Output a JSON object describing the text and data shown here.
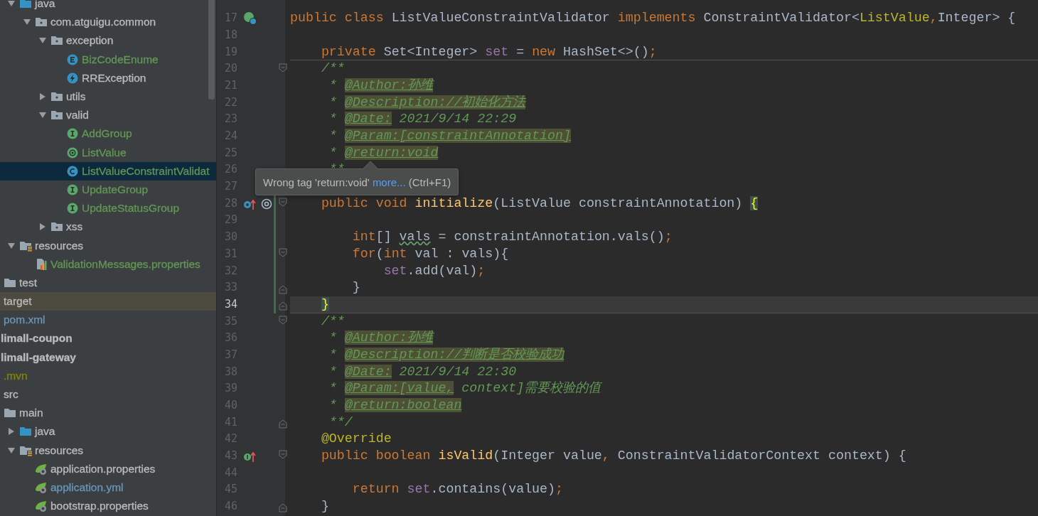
{
  "tree": [
    {
      "label": "java",
      "kind": "java-folder",
      "expanded": true,
      "selected": false,
      "color": "#bbbbbb",
      "children": [
        {
          "label": "com.atguigu.common",
          "kind": "package",
          "expanded": true,
          "selected": false,
          "color": "#bbbbbb",
          "children": [
            {
              "label": "exception",
              "kind": "package",
              "expanded": true,
              "selected": false,
              "color": "#bbbbbb",
              "children": [
                {
                  "label": "BizCodeEnume",
                  "kind": "enum",
                  "selected": false,
                  "color": "#629755"
                },
                {
                  "label": "RRException",
                  "kind": "exception",
                  "selected": false,
                  "color": "#bbbbbb"
                }
              ]
            },
            {
              "label": "utils",
              "kind": "package",
              "expanded": false,
              "selected": false,
              "color": "#bbbbbb"
            },
            {
              "label": "valid",
              "kind": "package",
              "expanded": true,
              "selected": false,
              "color": "#bbbbbb",
              "children": [
                {
                  "label": "AddGroup",
                  "kind": "interface",
                  "selected": false,
                  "color": "#629755"
                },
                {
                  "label": "ListValue",
                  "kind": "annotation",
                  "selected": false,
                  "color": "#629755"
                },
                {
                  "label": "ListValueConstraintValidat",
                  "kind": "class",
                  "selected": true,
                  "color": "#629755"
                },
                {
                  "label": "UpdateGroup",
                  "kind": "interface",
                  "selected": false,
                  "color": "#629755"
                },
                {
                  "label": "UpdateStatusGroup",
                  "kind": "interface",
                  "selected": false,
                  "color": "#629755"
                }
              ]
            },
            {
              "label": "xss",
              "kind": "package",
              "expanded": false,
              "selected": false,
              "color": "#bbbbbb"
            }
          ]
        }
      ]
    },
    {
      "label": "resources",
      "kind": "resource-folder",
      "expanded": true,
      "selected": false,
      "color": "#bbbbbb",
      "children": [
        {
          "label": "ValidationMessages.properties",
          "kind": "bundle",
          "selected": false,
          "color": "#629755"
        }
      ]
    },
    {
      "label": "test",
      "kind": "test-folder",
      "selected": false,
      "color": "#bbbbbb"
    },
    {
      "label": "target",
      "kind": "excluded-folder",
      "selected": false,
      "color": "#bbbbbb"
    },
    {
      "label": "pom.xml",
      "kind": "pom-file",
      "selected": false,
      "color": "#6897bb"
    },
    {
      "label": "limall-coupon",
      "kind": "module",
      "selected": false,
      "color": "#bbbbbb"
    },
    {
      "label": "limall-gateway",
      "kind": "module",
      "selected": false,
      "color": "#bbbbbb",
      "children": [
        {
          "label": ".mvn",
          "kind": "folder",
          "selected": false,
          "color": "#848504"
        },
        {
          "label": "src",
          "kind": "folder",
          "selected": false,
          "color": "#bbbbbb",
          "children": [
            {
              "label": "main",
              "kind": "folder",
              "selected": false,
              "color": "#bbbbbb",
              "children": [
                {
                  "label": "java",
                  "kind": "java-folder",
                  "expanded": false,
                  "selected": false,
                  "color": "#bbbbbb"
                },
                {
                  "label": "resources",
                  "kind": "resource-folder",
                  "expanded": true,
                  "selected": false,
                  "color": "#bbbbbb",
                  "children": [
                    {
                      "label": "application.properties",
                      "kind": "spring-config",
                      "selected": false,
                      "color": "#bbbbbb"
                    },
                    {
                      "label": "application.yml",
                      "kind": "spring-config",
                      "selected": false,
                      "color": "#6897bb"
                    },
                    {
                      "label": "bootstrap.properties",
                      "kind": "spring-config",
                      "selected": false,
                      "color": "#bbbbbb"
                    }
                  ]
                }
              ]
            }
          ]
        }
      ]
    }
  ],
  "editor": {
    "lines": [
      {
        "number": "17",
        "current": false,
        "separator": false,
        "changed": false,
        "gutter": {
          "kind": "subclassed"
        },
        "tokens": [
          {
            "kind": "keyword",
            "text": "public class "
          },
          {
            "kind": "plain",
            "text": "ListValueConstraintValidator "
          },
          {
            "kind": "keyword",
            "text": "implements "
          },
          {
            "kind": "plain",
            "text": "ConstraintValidator<"
          },
          {
            "kind": "generic",
            "text": "ListValue"
          },
          {
            "kind": "keyword",
            "text": ","
          },
          {
            "kind": "plain",
            "text": "Integer> {"
          }
        ]
      },
      {
        "number": "18",
        "current": false,
        "separator": false,
        "changed": false
      },
      {
        "number": "19",
        "current": false,
        "separator": true,
        "changed": false,
        "tokens": [
          {
            "kind": "keyword",
            "text": "    private "
          },
          {
            "kind": "plain",
            "text": "Set<Integer> "
          },
          {
            "kind": "field",
            "text": "set"
          },
          {
            "kind": "plain",
            "text": " = "
          },
          {
            "kind": "keyword",
            "text": "new "
          },
          {
            "kind": "plain",
            "text": "HashSet<>()"
          },
          {
            "kind": "keyword",
            "text": ";"
          }
        ]
      },
      {
        "number": "20",
        "current": false,
        "separator": false,
        "changed": false,
        "fold": {
          "kind": "start"
        },
        "tokens": [
          {
            "kind": "comment",
            "text": "    /**"
          }
        ]
      },
      {
        "number": "21",
        "current": false,
        "separator": false,
        "changed": false,
        "tokens": [
          {
            "kind": "comment",
            "text": "     * "
          },
          {
            "kind": "doc-tag",
            "text": "@Author:孙维"
          }
        ]
      },
      {
        "number": "22",
        "current": false,
        "separator": false,
        "changed": false,
        "tokens": [
          {
            "kind": "comment",
            "text": "     * "
          },
          {
            "kind": "doc-tag",
            "text": "@Description://初始化方法"
          }
        ]
      },
      {
        "number": "23",
        "current": false,
        "separator": false,
        "changed": false,
        "tokens": [
          {
            "kind": "comment",
            "text": "     * "
          },
          {
            "kind": "doc-tag",
            "text": "@Date:"
          },
          {
            "kind": "comment",
            "text": " 2021/9/14 22:29"
          }
        ]
      },
      {
        "number": "24",
        "current": false,
        "separator": false,
        "changed": false,
        "tokens": [
          {
            "kind": "comment",
            "text": "     * "
          },
          {
            "kind": "doc-tag",
            "text": "@Param:[constraintAnnotation]"
          }
        ]
      },
      {
        "number": "25",
        "current": false,
        "separator": false,
        "changed": false,
        "tokens": [
          {
            "kind": "comment",
            "text": "     * "
          },
          {
            "kind": "doc-tag",
            "text": "@return:void"
          }
        ]
      },
      {
        "number": "26",
        "current": false,
        "separator": false,
        "changed": false,
        "tokens": [
          {
            "kind": "comment",
            "text": "     **"
          }
        ]
      },
      {
        "number": "27",
        "current": false,
        "separator": false,
        "changed": false
      },
      {
        "number": "28",
        "current": false,
        "separator": false,
        "changed": true,
        "gutter": {
          "kind": "implementing-annotated"
        },
        "fold": {
          "kind": "start"
        },
        "tokens": [
          {
            "kind": "keyword",
            "text": "    public void "
          },
          {
            "kind": "method",
            "text": "initialize"
          },
          {
            "kind": "plain",
            "text": "(ListValue constraintAnnotation) "
          },
          {
            "kind": "brace-match",
            "text": "{"
          }
        ]
      },
      {
        "number": "29",
        "current": false,
        "separator": false,
        "changed": true
      },
      {
        "number": "30",
        "current": false,
        "separator": false,
        "changed": true,
        "tokens": [
          {
            "kind": "keyword",
            "text": "        int"
          },
          {
            "kind": "plain",
            "text": "[] "
          },
          {
            "kind": "typo",
            "text": "vals"
          },
          {
            "kind": "plain",
            "text": " = constraintAnnotation.vals()"
          },
          {
            "kind": "keyword",
            "text": ";"
          }
        ]
      },
      {
        "number": "31",
        "current": false,
        "separator": false,
        "changed": true,
        "fold": {
          "kind": "start"
        },
        "tokens": [
          {
            "kind": "keyword",
            "text": "        for"
          },
          {
            "kind": "plain",
            "text": "("
          },
          {
            "kind": "keyword",
            "text": "int "
          },
          {
            "kind": "plain",
            "text": "val : vals){"
          }
        ]
      },
      {
        "number": "32",
        "current": false,
        "separator": false,
        "changed": true,
        "tokens": [
          {
            "kind": "field",
            "text": "            set"
          },
          {
            "kind": "plain",
            "text": ".add(val)"
          },
          {
            "kind": "keyword",
            "text": ";"
          }
        ]
      },
      {
        "number": "33",
        "current": false,
        "separator": false,
        "changed": true,
        "fold": {
          "kind": "end"
        },
        "tokens": [
          {
            "kind": "plain",
            "text": "        }"
          }
        ]
      },
      {
        "number": "34",
        "current": true,
        "separator": true,
        "changed": true,
        "fold": {
          "kind": "end"
        },
        "tokens": [
          {
            "kind": "brace-match",
            "text": "    }"
          }
        ]
      },
      {
        "number": "35",
        "current": false,
        "separator": false,
        "changed": false,
        "fold": {
          "kind": "start"
        },
        "tokens": [
          {
            "kind": "comment",
            "text": "    /**"
          }
        ]
      },
      {
        "number": "36",
        "current": false,
        "separator": false,
        "changed": false,
        "tokens": [
          {
            "kind": "comment",
            "text": "     * "
          },
          {
            "kind": "doc-tag",
            "text": "@Author:孙维"
          }
        ]
      },
      {
        "number": "37",
        "current": false,
        "separator": false,
        "changed": false,
        "tokens": [
          {
            "kind": "comment",
            "text": "     * "
          },
          {
            "kind": "doc-tag",
            "text": "@Description://判断是否校验成功"
          }
        ]
      },
      {
        "number": "38",
        "current": false,
        "separator": false,
        "changed": false,
        "tokens": [
          {
            "kind": "comment",
            "text": "     * "
          },
          {
            "kind": "doc-tag",
            "text": "@Date:"
          },
          {
            "kind": "comment",
            "text": " 2021/9/14 22:30"
          }
        ]
      },
      {
        "number": "39",
        "current": false,
        "separator": false,
        "changed": false,
        "tokens": [
          {
            "kind": "comment",
            "text": "     * "
          },
          {
            "kind": "doc-tag",
            "text": "@Param:[value,"
          },
          {
            "kind": "comment",
            "text": " context]需要校验的值"
          }
        ]
      },
      {
        "number": "40",
        "current": false,
        "separator": false,
        "changed": false,
        "tokens": [
          {
            "kind": "comment",
            "text": "     * "
          },
          {
            "kind": "doc-tag",
            "text": "@return:boolean"
          }
        ]
      },
      {
        "number": "41",
        "current": false,
        "separator": false,
        "changed": false,
        "fold": {
          "kind": "end"
        },
        "tokens": [
          {
            "kind": "comment",
            "text": "     **/"
          }
        ]
      },
      {
        "number": "42",
        "current": false,
        "separator": false,
        "changed": false,
        "tokens": [
          {
            "kind": "annotation",
            "text": "    @Override"
          }
        ]
      },
      {
        "number": "43",
        "current": false,
        "separator": false,
        "changed": false,
        "gutter": {
          "kind": "implementing"
        },
        "fold": {
          "kind": "start"
        },
        "tokens": [
          {
            "kind": "keyword",
            "text": "    public boolean "
          },
          {
            "kind": "method",
            "text": "isValid"
          },
          {
            "kind": "plain",
            "text": "(Integer value"
          },
          {
            "kind": "keyword",
            "text": ", "
          },
          {
            "kind": "plain",
            "text": "ConstraintValidatorContext context) {"
          }
        ]
      },
      {
        "number": "44",
        "current": false,
        "separator": false,
        "changed": false
      },
      {
        "number": "45",
        "current": false,
        "separator": false,
        "changed": false,
        "tokens": [
          {
            "kind": "keyword",
            "text": "        return "
          },
          {
            "kind": "field",
            "text": "set"
          },
          {
            "kind": "plain",
            "text": ".contains(value)"
          },
          {
            "kind": "keyword",
            "text": ";"
          }
        ]
      },
      {
        "number": "46",
        "current": false,
        "separator": false,
        "changed": false,
        "fold": {
          "kind": "end"
        },
        "tokens": [
          {
            "kind": "plain",
            "text": "    }"
          }
        ]
      }
    ]
  },
  "tooltip": {
    "message": "Wrong tag 'return:void'",
    "link": "more...",
    "shortcut": "(Ctrl+F1)"
  }
}
